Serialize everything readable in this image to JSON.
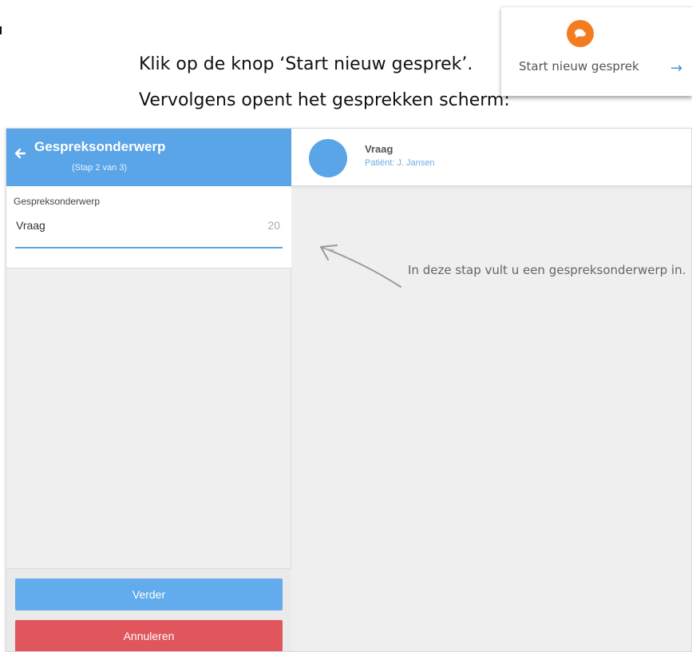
{
  "instructions": {
    "line1": "Klik op de knop ‘Start nieuw gesprek’.",
    "line2": "Vervolgens opent het gesprekken scherm:"
  },
  "start_card": {
    "label": "Start nieuw gesprek",
    "arrow": "→",
    "icon": "chat-bubble-icon",
    "icon_color": "#f47c20"
  },
  "left_panel": {
    "title": "Gespreksonderwerp",
    "subtitle": "(Stap 2 van 3)",
    "header_color": "#5aa4e8",
    "field": {
      "label": "Gespreksonderwerp",
      "value": "Vraag",
      "remaining_chars": "20"
    },
    "buttons": {
      "next": "Verder",
      "cancel": "Annuleren",
      "next_color": "#62abec",
      "cancel_color": "#e0565c"
    }
  },
  "right_panel": {
    "conversation_title": "Vraag",
    "patient_line": "Patiënt: J. Jansen",
    "hint": "In deze stap vult u een gespreksonderwerp in."
  }
}
